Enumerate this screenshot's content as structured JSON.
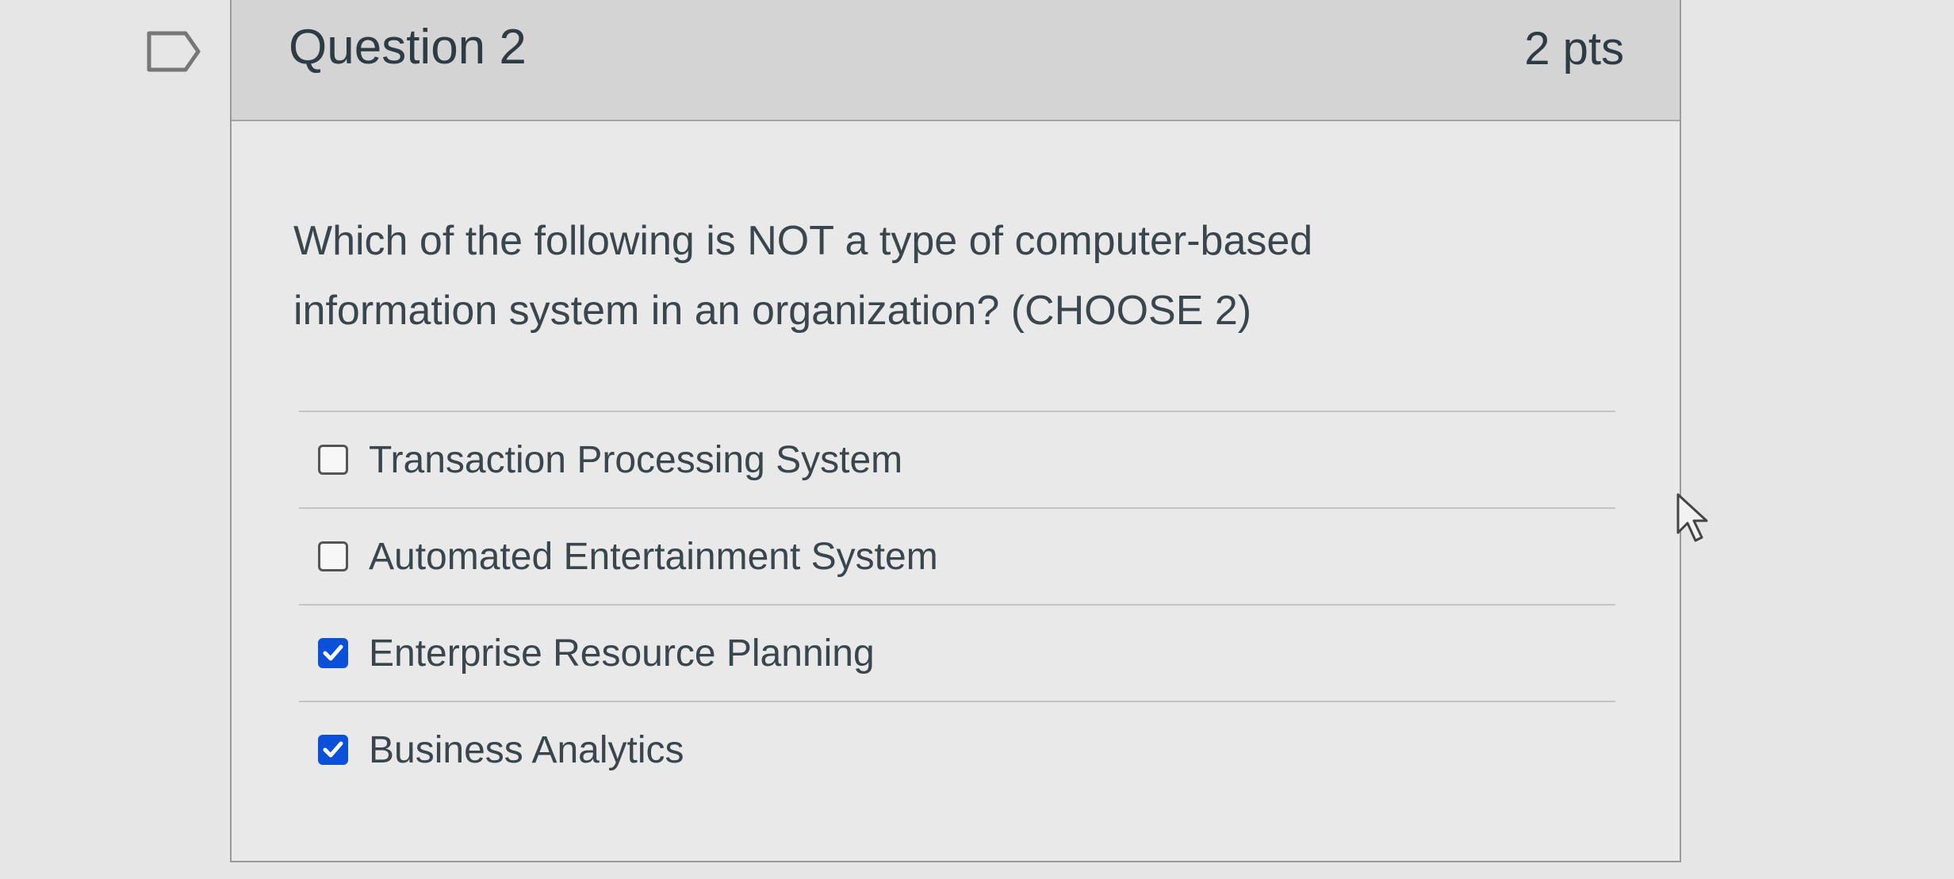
{
  "question": {
    "title": "Question 2",
    "points": "2 pts",
    "text": "Which of the following is NOT a type of computer-based information system in an organization? (CHOOSE 2)"
  },
  "answers": [
    {
      "label": "Transaction Processing System",
      "checked": false
    },
    {
      "label": "Automated Entertainment System",
      "checked": false
    },
    {
      "label": "Enterprise Resource Planning",
      "checked": true
    },
    {
      "label": "Business Analytics",
      "checked": true
    }
  ],
  "icons": {
    "flag": "flag-icon",
    "checkbox": "checkbox-icon",
    "check": "checkmark-icon",
    "cursor": "mouse-pointer-icon"
  },
  "colors": {
    "checked": "#0a50d8",
    "text": "#2d3b45",
    "header_bg": "#d4d4d4"
  }
}
